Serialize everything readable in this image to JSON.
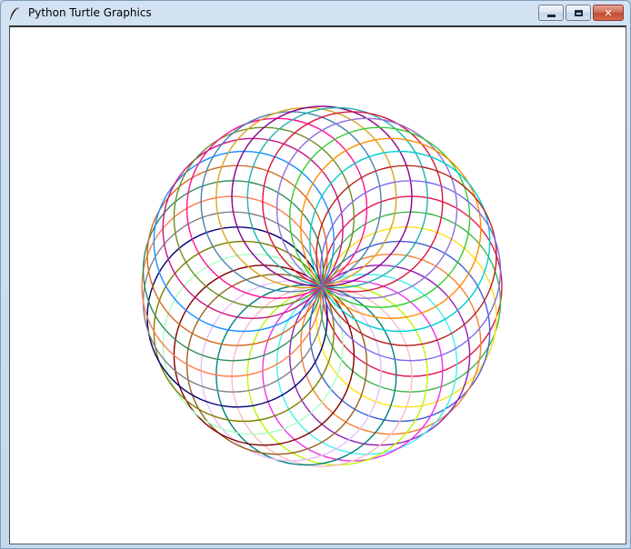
{
  "window": {
    "title": "Python Turtle Graphics",
    "icon": "feather-icon",
    "controls": {
      "minimize": "minimize-icon",
      "maximize": "maximize-icon",
      "close": "close-icon"
    },
    "close_symbol": "✕"
  },
  "drawing": {
    "shape": "spirograph",
    "circle_count": 36,
    "colors": [
      "#e6194b",
      "#3cb44b",
      "#ffe119",
      "#4363d8",
      "#f58231",
      "#911eb4",
      "#46f0f0",
      "#f032e6",
      "#bcf60c",
      "#fabebe",
      "#008080",
      "#e6beff",
      "#9a6324",
      "#800000",
      "#aaffc3",
      "#808000",
      "#000075",
      "#808080",
      "#ff7f50",
      "#2e8b57",
      "#d2691e",
      "#1e90ff",
      "#c71585",
      "#6b8e23",
      "#ff1493",
      "#4682b4",
      "#daa520",
      "#8b008b",
      "#20b2aa",
      "#dc143c",
      "#9370db",
      "#32cd32",
      "#ff8c00",
      "#00ced1",
      "#b22222",
      "#7b68ee"
    ]
  }
}
